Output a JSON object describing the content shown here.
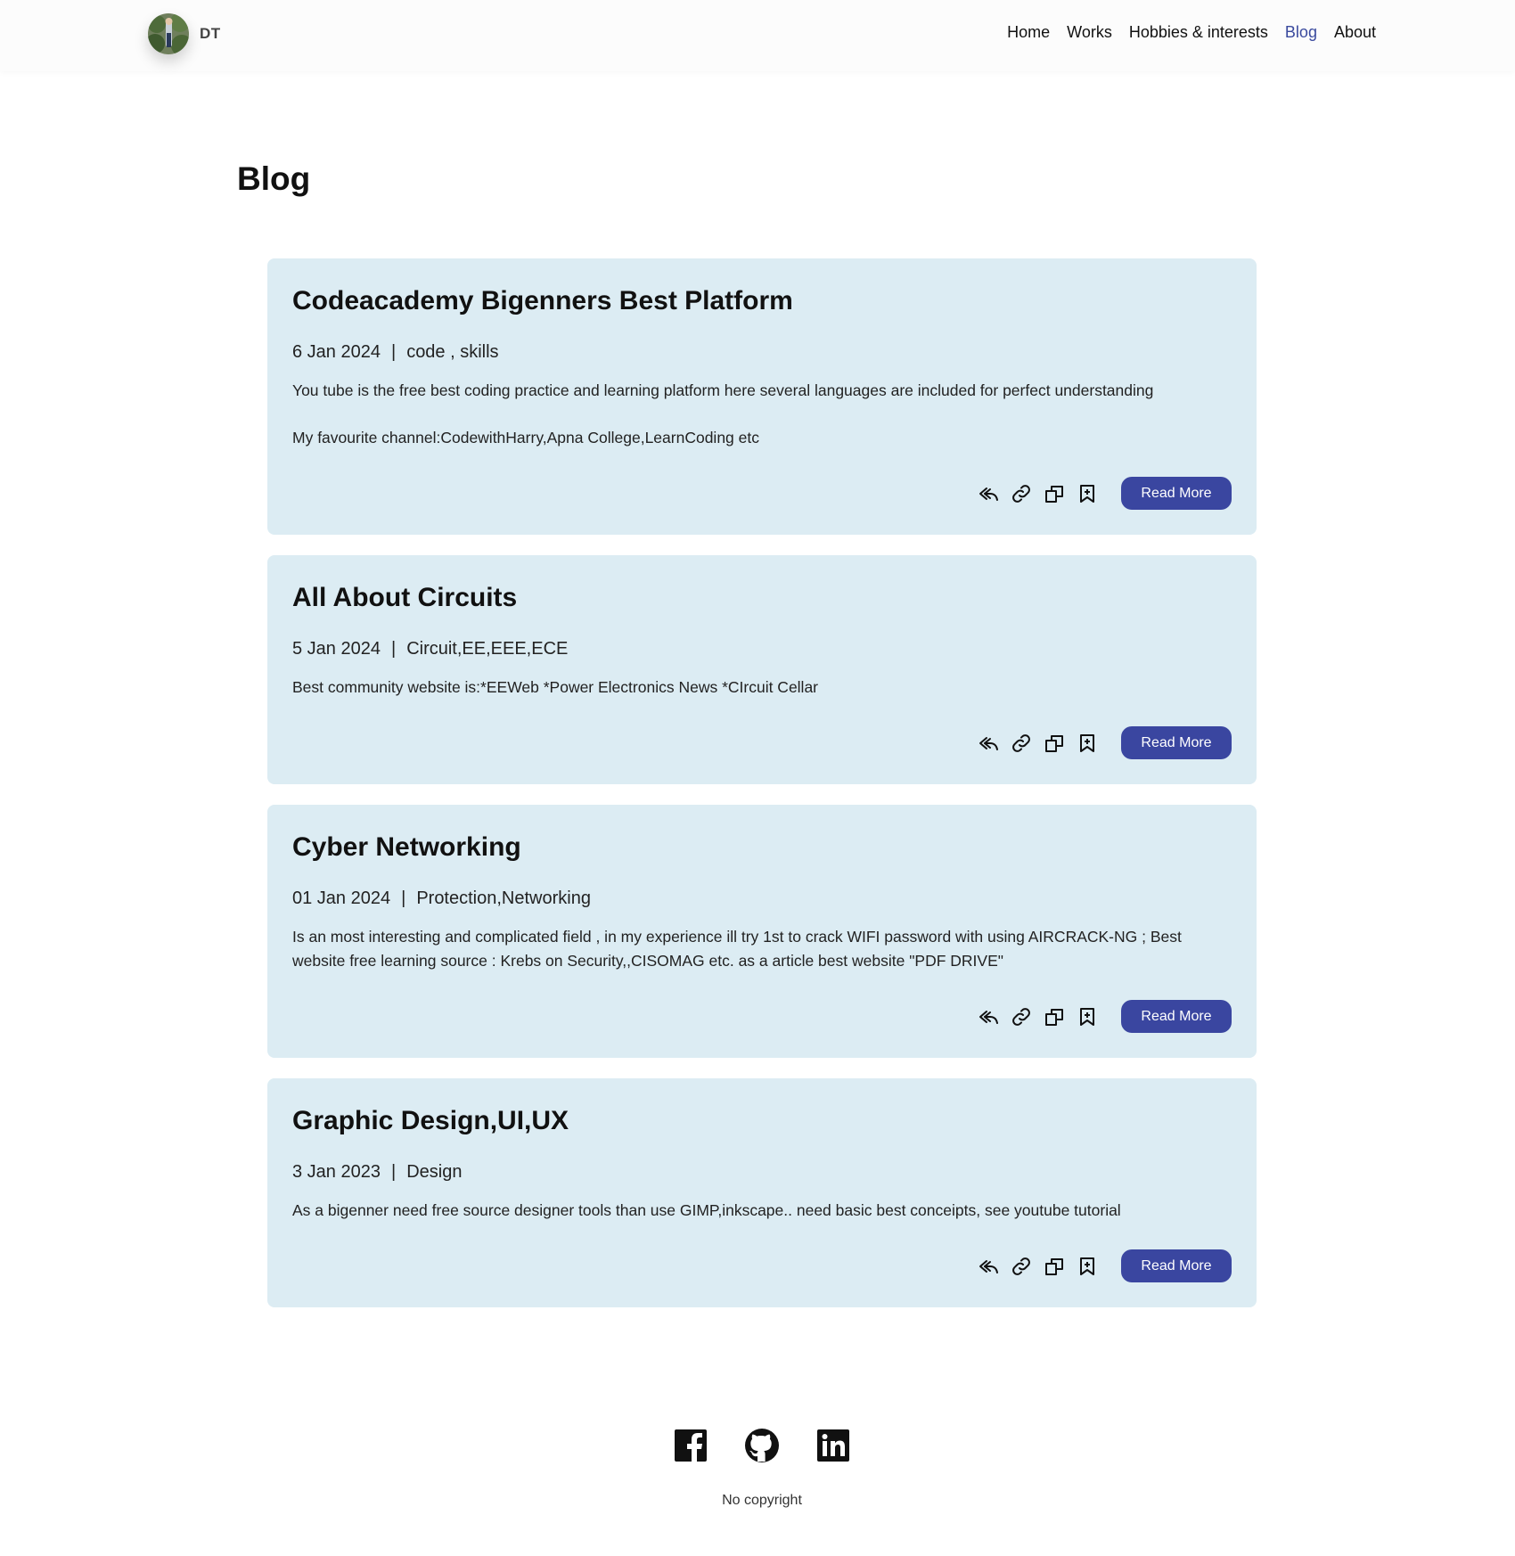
{
  "brand": {
    "name": "DT",
    "avatar_icon": "avatar-photo"
  },
  "nav": {
    "items": [
      {
        "label": "Home"
      },
      {
        "label": "Works"
      },
      {
        "label": "Hobbies & interests"
      },
      {
        "label": "Blog",
        "active": true
      },
      {
        "label": "About"
      }
    ]
  },
  "page": {
    "title": "Blog"
  },
  "posts": [
    {
      "title": "Codeacademy Bigenners Best Platform",
      "date": "6 Jan 2024",
      "tags": "code , skills",
      "description": "You tube is the free best coding practice and learning platform here several languages are included for perfect understanding",
      "extra": "My favourite channel:CodewithHarry,Apna College,LearnCoding etc",
      "read_more": "Read More"
    },
    {
      "title": "All About Circuits",
      "date": "5 Jan 2024",
      "tags": "Circuit,EE,EEE,ECE",
      "description": "Best community website is:*EEWeb *Power Electronics News *CIrcuit Cellar",
      "read_more": "Read More"
    },
    {
      "title": "Cyber Networking",
      "date": "01 Jan 2024",
      "tags": "Protection,Networking",
      "description": "Is an most interesting and complicated field , in my experience ill try 1st to crack WIFI password with using AIRCRACK-NG ; Best website free learning source : Krebs on Security,,CISOMAG etc. as a article best website \"PDF DRIVE\"",
      "read_more": "Read More"
    },
    {
      "title": "Graphic Design,UI,UX",
      "date": "3 Jan 2023",
      "tags": "Design",
      "description": "As a bigenner need free source designer tools than use GIMP,inkscape.. need basic best conceipts, see youtube tutorial",
      "read_more": "Read More"
    }
  ],
  "post_action_icons": [
    "reply-icon",
    "link-icon",
    "copy-icon",
    "bookmark-add-icon"
  ],
  "footer": {
    "socials": [
      "facebook-icon",
      "github-icon",
      "linkedin-icon"
    ],
    "copyright": "No copyright"
  },
  "colors": {
    "accent": "#3a46a0",
    "nav_active": "#3a4a9e",
    "card_bg": "#dcecf3"
  }
}
